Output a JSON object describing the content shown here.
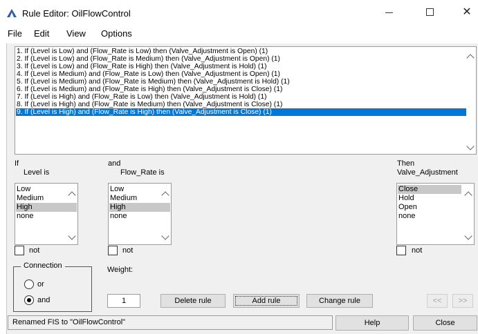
{
  "window": {
    "title": "Rule Editor: OilFlowControl",
    "minimize_glyph": "—",
    "maximize_glyph": "☐",
    "close_glyph": "✕",
    "icon": "matlab-icon"
  },
  "menu": [
    "File",
    "Edit",
    "View",
    "Options"
  ],
  "rules": [
    "1. If (Level is Low) and (Flow_Rate is Low) then (Valve_Adjustment is Open) (1)",
    "2. If (Level is Low) and (Flow_Rate is Medium) then (Valve_Adjustment is Open) (1)",
    "3. If (Level is Low) and (Flow_Rate is High) then (Valve_Adjustment is Hold) (1)",
    "4. If (Level is Medium) and (Flow_Rate is Low) then (Valve_Adjustment is Open) (1)",
    "5. If (Level is Medium) and (Flow_Rate is Medium) then (Valve_Adjustment is Hold) (1)",
    "6. If (Level is Medium) and (Flow_Rate is High) then (Valve_Adjustment is Close) (1)",
    "7. If (Level is High) and (Flow_Rate is Low) then (Valve_Adjustment is Hold) (1)",
    "8. If (Level is High) and (Flow_Rate is Medium) then (Valve_Adjustment is Close) (1)",
    "9. If (Level is High) and (Flow_Rate is High) then (Valve_Adjustment is Close) (1)"
  ],
  "selected_rule_index": 8,
  "if_section": {
    "header": "If",
    "label": "Level is",
    "options": [
      "Low",
      "Medium",
      "High",
      "none"
    ],
    "selected": "High",
    "not_label": "not"
  },
  "and_section": {
    "header": "and",
    "label": "Flow_Rate is",
    "options": [
      "Low",
      "Medium",
      "High",
      "none"
    ],
    "selected": "High",
    "not_label": "not"
  },
  "then_section": {
    "header": "Then",
    "label": "Valve_Adjustment",
    "options": [
      "Close",
      "Hold",
      "Open",
      "none"
    ],
    "selected": "Close",
    "not_label": "not"
  },
  "connection": {
    "legend": "Connection",
    "or_label": "or",
    "and_label": "and",
    "selected": "and"
  },
  "weight": {
    "label": "Weight:",
    "value": "1"
  },
  "buttons": {
    "delete": "Delete rule",
    "add": "Add rule",
    "change": "Change rule",
    "prev": "<<",
    "next": ">>",
    "help": "Help",
    "close": "Close"
  },
  "status": "Renamed FIS to \"OilFlowControl\"",
  "colors": {
    "selection": "#0078d7",
    "panel": "#f0f0f0",
    "list_selection": "#c8c8c8",
    "icon": "#2f5da8"
  }
}
